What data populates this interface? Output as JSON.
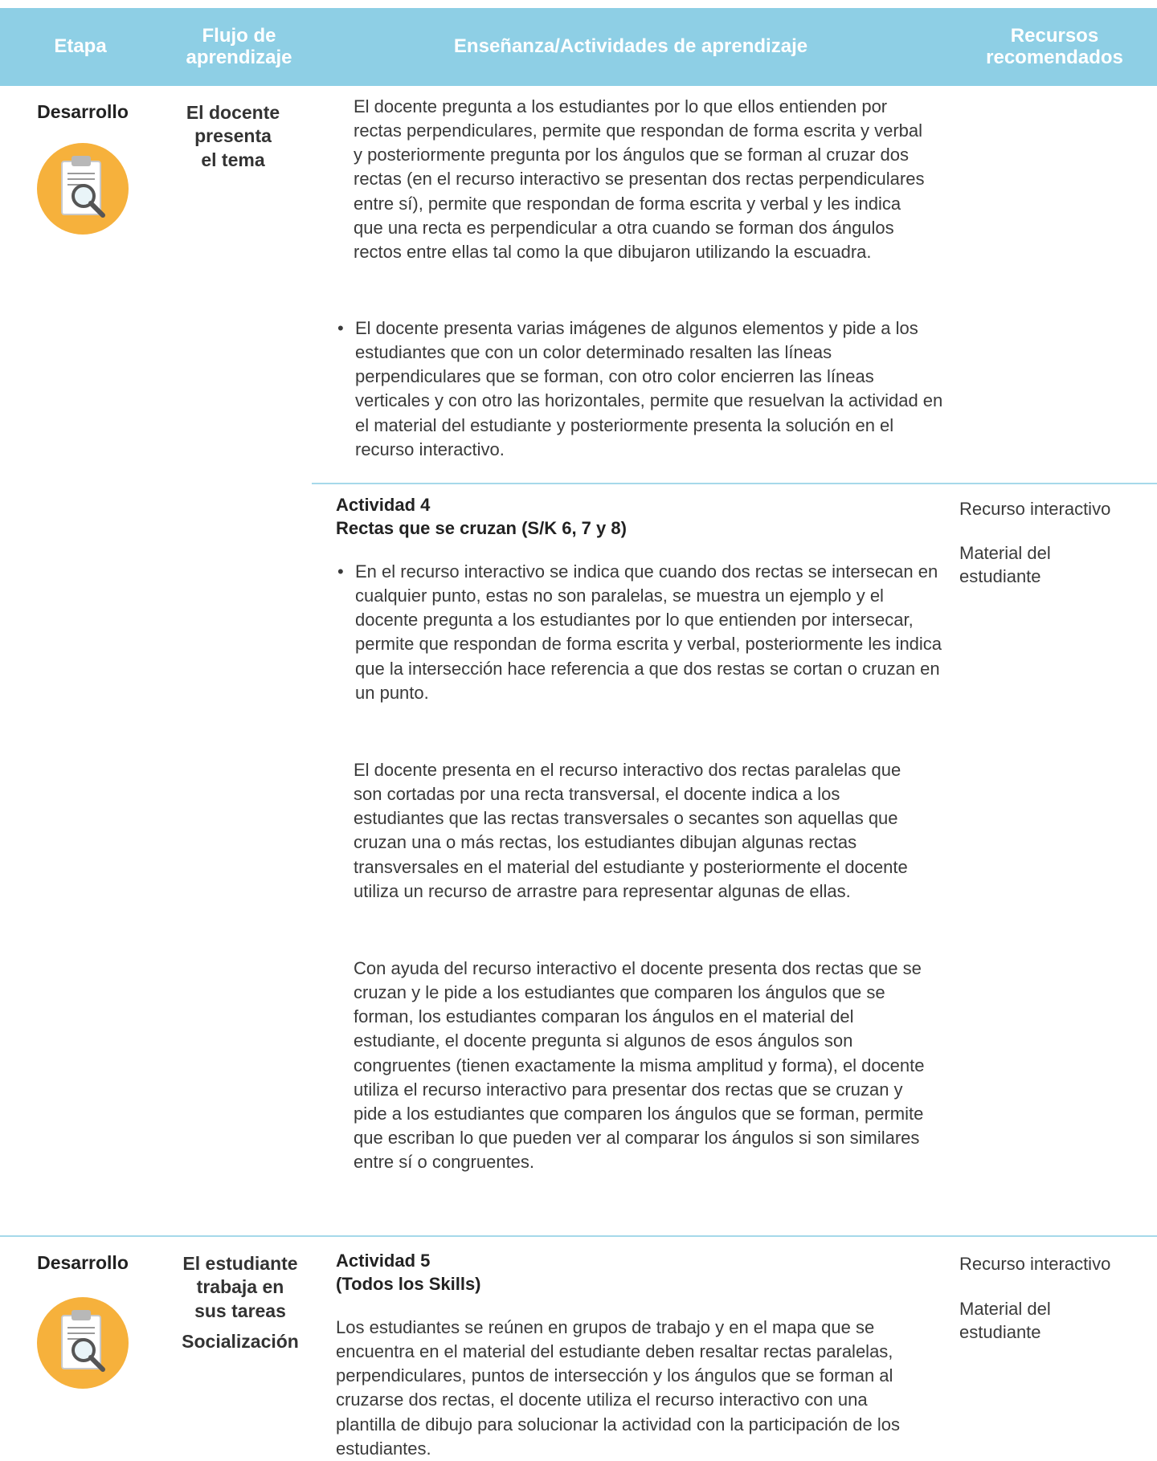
{
  "header": {
    "etapa": "Etapa",
    "flujo": "Flujo de aprendizaje",
    "ensenanza": "Enseñanza/Actividades de aprendizaje",
    "recursos": "Recursos recomendados"
  },
  "row1": {
    "stage": "Desarrollo",
    "flow": [
      "El docente",
      "presenta",
      "el tema"
    ],
    "p1": "El docente pregunta a los estudiantes por lo que ellos entienden por rectas perpendiculares, permite que respondan de forma escrita y verbal y posteriormente pregunta por los ángulos que se forman al cruzar dos rectas (en el recurso interactivo se presentan dos rectas perpendiculares entre sí), permite que respondan de forma escrita y verbal y les indica que una recta es perpendicular a otra cuando se forman dos ángulos rectos entre ellas tal como la que dibujaron utilizando la escuadra.",
    "p2": "El docente presenta varias imágenes de algunos elementos y pide a los estudiantes que con un color determinado resalten las líneas perpendiculares que se forman, con otro color encierren las líneas verticales y con otro las horizontales, permite que resuelvan la actividad en el material del estudiante y posteriormente presenta la solución en el recurso interactivo.",
    "activity_title": "Actividad 4",
    "activity_subtitle": "Rectas que se cruzan (S/K 6, 7 y 8)",
    "p3": "En el recurso interactivo se indica que cuando dos rectas se intersecan en cualquier punto, estas no son paralelas, se muestra un ejemplo y el docente pregunta a los estudiantes por lo que entienden por intersecar, permite que respondan de forma escrita y verbal, posteriormente les indica que la intersección hace referencia a que dos restas se cortan o cruzan en un punto.",
    "p4": "El docente presenta en el recurso interactivo dos rectas paralelas que son cortadas por una recta transversal, el docente indica a los estudiantes que las rectas transversales o secantes son aquellas que cruzan una o más rectas, los estudiantes dibujan algunas rectas transversales en el material del estudiante y posteriormente el docente utiliza un recurso de arrastre para representar algunas de ellas.",
    "p5": "Con ayuda del recurso interactivo el docente presenta dos rectas que se cruzan y le pide a los estudiantes que comparen los ángulos que se forman, los estudiantes comparan los ángulos en el material del estudiante, el docente pregunta si algunos de esos ángulos son congruentes (tienen exactamente la misma amplitud y forma), el docente utiliza el recurso interactivo para presentar dos rectas que se cruzan y pide a los estudiantes que comparen los ángulos que se forman, permite que escriban lo que pueden ver al comparar los ángulos si son similares entre sí o congruentes.",
    "resources": [
      "Recurso interactivo",
      "Material del estudiante"
    ]
  },
  "row2": {
    "stage": "Desarrollo",
    "flow": [
      "El estudiante",
      "trabaja en",
      "sus tareas"
    ],
    "flow2": "Socialización",
    "activity_title": "Actividad 5",
    "activity_subtitle": "(Todos los Skills)",
    "p1": "Los estudiantes se reúnen en grupos de trabajo y en el mapa que se encuentra en el material del estudiante deben resaltar rectas paralelas, perpendiculares, puntos de intersección y los ángulos que se forman al cruzarse dos rectas, el docente utiliza el recurso interactivo con una plantilla de dibujo para solucionar la actividad con la participación de los estudiantes.",
    "resources": [
      "Recurso interactivo",
      "Material del estudiante"
    ]
  },
  "bullet": "•",
  "colors": {
    "header_bg": "#8ecfe5",
    "divider": "#a6d9ea",
    "icon_circle": "#f6b13c"
  }
}
